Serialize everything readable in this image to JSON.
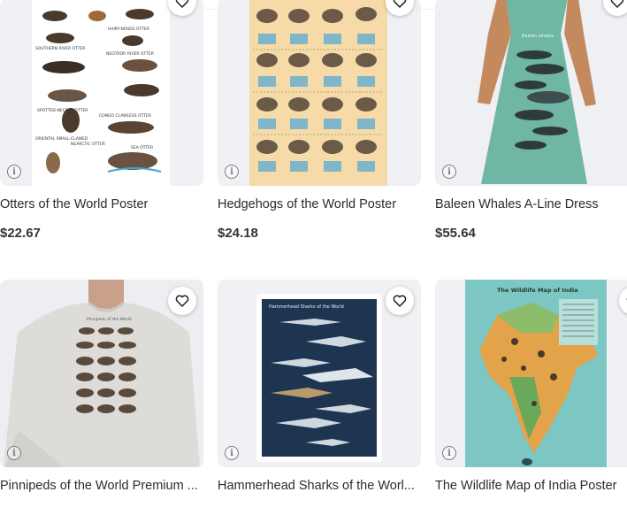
{
  "icons": {
    "favorite": "heart-outline-icon",
    "info": "info-icon"
  },
  "products": [
    {
      "title": "Otters of the World Poster",
      "price": "$22.67"
    },
    {
      "title": "Hedgehogs of the World Poster",
      "price": "$24.18"
    },
    {
      "title": "Baleen Whales A-Line Dress",
      "price": "$55.64",
      "image_label": "Baleen whales"
    },
    {
      "title": "Pinnipeds of the World Premium ...",
      "price": "",
      "image_label": "Pinnipeds of the World"
    },
    {
      "title": "Hammerhead Sharks of the Worl...",
      "price": "",
      "image_label": "Hammerhead Sharks of the World"
    },
    {
      "title": "The Wildlife Map of India Poster",
      "price": "",
      "image_label": "The Wildlife Map of India"
    }
  ],
  "info_glyph": "i"
}
